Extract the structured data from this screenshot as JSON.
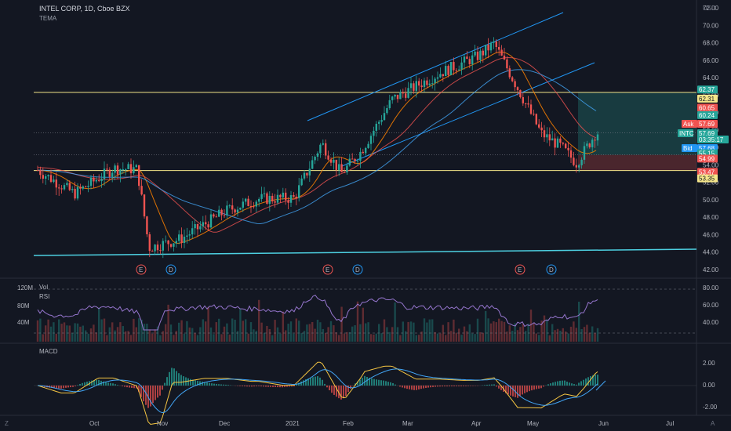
{
  "header": {
    "title": "INTEL CORP, 1D, Cboe BZX",
    "indicator": "TEMA",
    "currency": "USD"
  },
  "colors": {
    "background": "#131722",
    "up": "#26a69a",
    "down": "#ef5350",
    "channel": "#2196f3",
    "support": "#f5e68a",
    "bottom_line": "#4dd0e1",
    "orange_ma": "#f57c00",
    "red_ma": "#ef5350",
    "blue_ma": "#42a5f5",
    "rsi": "#9575cd",
    "macd": "#f5c542",
    "signal": "#42a5f5"
  },
  "price_pane": {
    "y_ticks": [
      "72.00",
      "70.00",
      "68.00",
      "66.00",
      "64.00",
      "62.00",
      "60.00",
      "58.00",
      "56.00",
      "54.00",
      "52.00",
      "50.00",
      "48.00",
      "46.00",
      "44.00",
      "42.00"
    ],
    "x_ticks": [
      "Oct",
      "Nov",
      "Dec",
      "2021",
      "Feb",
      "Mar",
      "Apr",
      "May",
      "Jun",
      "Jul"
    ],
    "labels": [
      {
        "text": "62.37",
        "color": "#26a69a"
      },
      {
        "text": "62.31",
        "color": "#f5e68a"
      },
      {
        "text": "60.65",
        "color": "#ef5350"
      },
      {
        "text": "60.24",
        "color": "#26a69a"
      },
      {
        "text": "Ask",
        "color": "#ef5350"
      },
      {
        "text": "57.69",
        "color": "#ef5350"
      },
      {
        "text": "INTC",
        "color": "#26a69a"
      },
      {
        "text": "57.69",
        "color": "#26a69a"
      },
      {
        "text": "03:35:17",
        "color": "#26a69a"
      },
      {
        "text": "Bid",
        "color": "#2196f3"
      },
      {
        "text": "57.68",
        "color": "#2196f3"
      },
      {
        "text": "55.15",
        "color": "#26a69a"
      },
      {
        "text": "54.99",
        "color": "#ef5350"
      },
      {
        "text": "53.47",
        "color": "#ef5350"
      },
      {
        "text": "53.35",
        "color": "#f5e68a"
      }
    ],
    "events": [
      "E",
      "D",
      "E",
      "D",
      "E",
      "D"
    ]
  },
  "vol_rsi_pane": {
    "title_vol": "Vol",
    "title_rsi": "RSI",
    "left_ticks": [
      "120M",
      "80M",
      "40M"
    ],
    "right_ticks": [
      "80.00",
      "60.00",
      "40.00"
    ]
  },
  "macd_pane": {
    "title": "MACD",
    "right_ticks": [
      "2.00",
      "0.00",
      "-2.00"
    ]
  },
  "chart_data": {
    "type": "line",
    "title": "INTEL CORP, 1D, Cboe BZX",
    "series": [
      {
        "name": "INTC",
        "x": [
          "Sep-20",
          "Oct-1",
          "Oct-15",
          "Oct-22",
          "Nov-1",
          "Nov-15",
          "Dec-1",
          "Dec-15",
          "2021-1",
          "Jan-15",
          "Jan-22",
          "Feb-1",
          "Feb-15",
          "Mar-1",
          "Mar-15",
          "Apr-1",
          "Apr-8",
          "Apr-15",
          "Apr-23",
          "May-1",
          "May-12",
          "May-28"
        ],
        "values": [
          53.4,
          50.7,
          53.6,
          53.5,
          44.5,
          45.5,
          48.8,
          50.1,
          50.2,
          56.5,
          53.0,
          55.5,
          61.5,
          62.5,
          64.5,
          66.5,
          67.9,
          62.8,
          57.6,
          56.1,
          54.2,
          57.69
        ]
      }
    ],
    "ylim": [
      42,
      72
    ],
    "current_price": 57.69,
    "horizontal_levels": [
      62.31,
      53.35
    ]
  }
}
